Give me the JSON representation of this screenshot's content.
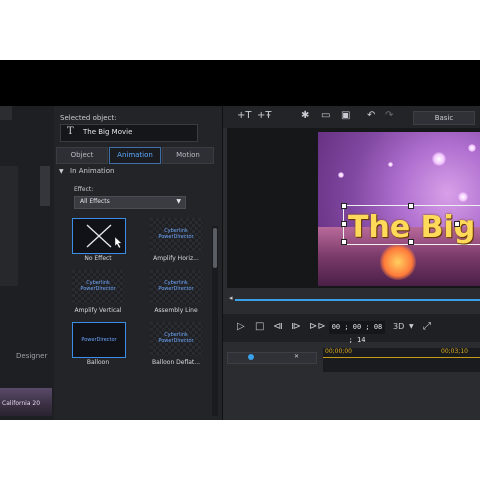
{
  "panel": {
    "selected_label": "Selected object:",
    "selected_value": "The Big Movie",
    "tabs": [
      {
        "label": "Object"
      },
      {
        "label": "Animation"
      },
      {
        "label": "Motion"
      }
    ],
    "active_tab": "Animation",
    "section_title": "In Animation",
    "effect_label": "Effect:",
    "effect_value": "All Effects",
    "effects": [
      {
        "label": "No Effect",
        "thumb_text": ""
      },
      {
        "label": "Amplify Horiz...",
        "thumb_text": "Cyberlink PowerDirector"
      },
      {
        "label": "Amplify Vertical",
        "thumb_text": "Cyberlink PowerDirector"
      },
      {
        "label": "Assembly Line",
        "thumb_text": "Cyberlink PowerDirector"
      },
      {
        "label": "Balloon",
        "thumb_text": "PowerDirector"
      },
      {
        "label": "Balloon Deflat...",
        "thumb_text": "Cyberlink PowerDirector"
      }
    ]
  },
  "sidebar": {
    "designer_label": "Designer",
    "thumb_caption": "California 20"
  },
  "preview": {
    "mode_label": "Basic",
    "title_text": "The Big M",
    "timecode": "00 ; 00 ; 08 ; 14",
    "mode_3d": "3D",
    "ruler_ticks": [
      "00;00;00",
      "00;03;10"
    ]
  },
  "colors": {
    "accent": "#3aa0e8",
    "tab_active": "#5aa8ff",
    "title_gold": "#ffd95a"
  }
}
